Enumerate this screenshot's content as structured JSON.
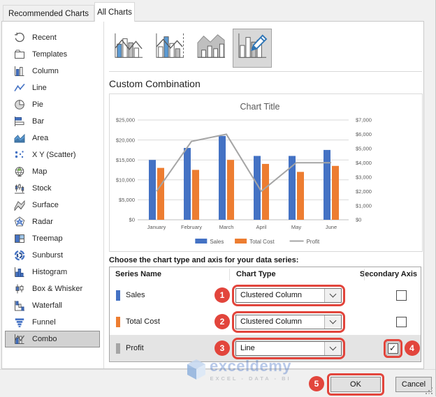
{
  "tabs": [
    {
      "label": "Recommended Charts",
      "active": false
    },
    {
      "label": "All Charts",
      "active": true
    }
  ],
  "sidebar": {
    "items": [
      {
        "label": "Recent",
        "icon": "recent-icon"
      },
      {
        "label": "Templates",
        "icon": "templates-icon"
      },
      {
        "label": "Column",
        "icon": "column-icon"
      },
      {
        "label": "Line",
        "icon": "line-icon"
      },
      {
        "label": "Pie",
        "icon": "pie-icon"
      },
      {
        "label": "Bar",
        "icon": "bar-icon"
      },
      {
        "label": "Area",
        "icon": "area-icon"
      },
      {
        "label": "X Y (Scatter)",
        "icon": "scatter-icon"
      },
      {
        "label": "Map",
        "icon": "map-icon"
      },
      {
        "label": "Stock",
        "icon": "stock-icon"
      },
      {
        "label": "Surface",
        "icon": "surface-icon"
      },
      {
        "label": "Radar",
        "icon": "radar-icon"
      },
      {
        "label": "Treemap",
        "icon": "treemap-icon"
      },
      {
        "label": "Sunburst",
        "icon": "sunburst-icon"
      },
      {
        "label": "Histogram",
        "icon": "histogram-icon"
      },
      {
        "label": "Box & Whisker",
        "icon": "box-whisker-icon"
      },
      {
        "label": "Waterfall",
        "icon": "waterfall-icon"
      },
      {
        "label": "Funnel",
        "icon": "funnel-icon"
      },
      {
        "label": "Combo",
        "icon": "combo-icon",
        "selected": true
      }
    ]
  },
  "combo_variants": [
    {
      "name": "clustered-column-line-icon",
      "selected": false
    },
    {
      "name": "clustered-column-line-secondary-axis-icon",
      "selected": false
    },
    {
      "name": "stacked-area-clustered-column-icon",
      "selected": false
    },
    {
      "name": "custom-combination-icon",
      "selected": true
    }
  ],
  "content": {
    "section_title": "Custom Combination",
    "choose_label": "Choose the chart type and axis for your data series:"
  },
  "chart_data": {
    "type": "combo",
    "title": "Chart Title",
    "categories": [
      "January",
      "February",
      "March",
      "April",
      "May",
      "June"
    ],
    "series": [
      {
        "name": "Sales",
        "type": "column",
        "axis": "primary",
        "color": "#4472C4",
        "values": [
          15000,
          18000,
          21000,
          16000,
          16000,
          17500
        ]
      },
      {
        "name": "Total Cost",
        "type": "column",
        "axis": "primary",
        "color": "#ED7D31",
        "values": [
          13000,
          12500,
          15000,
          14000,
          12000,
          13500
        ]
      },
      {
        "name": "Profit",
        "type": "line",
        "axis": "secondary",
        "color": "#A5A5A5",
        "values": [
          2000,
          5500,
          6000,
          2000,
          4000,
          4000
        ]
      }
    ],
    "primary_axis": {
      "min": 0,
      "max": 25000,
      "ticks": [
        "$0",
        "$5,000",
        "$10,000",
        "$15,000",
        "$20,000",
        "$25,000"
      ]
    },
    "secondary_axis": {
      "min": 0,
      "max": 7000,
      "ticks": [
        "$0",
        "$1,000",
        "$2,000",
        "$3,000",
        "$4,000",
        "$5,000",
        "$6,000",
        "$7,000"
      ]
    },
    "legend": [
      "Sales",
      "Total Cost",
      "Profit"
    ],
    "legend_position": "bottom",
    "grid": true,
    "text_color": "#595959",
    "grid_color": "#d9d9d9"
  },
  "series_table": {
    "headers": [
      "Series Name",
      "Chart Type",
      "Secondary Axis"
    ],
    "rows": [
      {
        "name": "Sales",
        "color": "#4472C4",
        "chart_type": "Clustered Column",
        "secondary_axis": false,
        "selected": false
      },
      {
        "name": "Total Cost",
        "color": "#ED7D31",
        "chart_type": "Clustered Column",
        "secondary_axis": false,
        "selected": false
      },
      {
        "name": "Profit",
        "color": "#A5A5A5",
        "chart_type": "Line",
        "secondary_axis": true,
        "selected": true
      }
    ]
  },
  "annotations": {
    "steps": [
      "1",
      "2",
      "3",
      "4",
      "5"
    ],
    "color": "#e2453c"
  },
  "watermark": {
    "brand": "exceldemy",
    "tagline": "EXCEL - DATA - BI"
  },
  "footer": {
    "ok_label": "OK",
    "cancel_label": "Cancel"
  }
}
